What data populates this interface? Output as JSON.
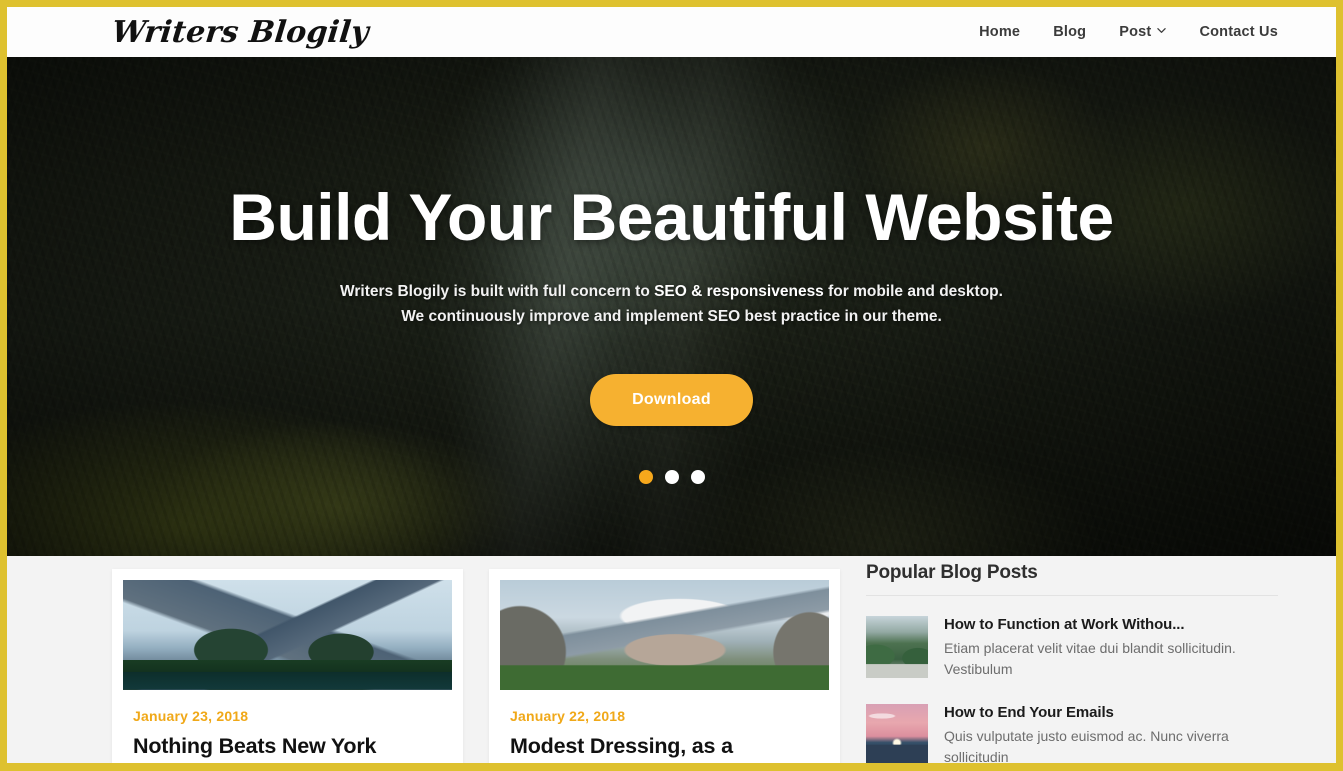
{
  "header": {
    "logo": "Writers Blogily",
    "nav": [
      {
        "label": "Home",
        "has_dropdown": false
      },
      {
        "label": "Blog",
        "has_dropdown": false
      },
      {
        "label": "Post",
        "has_dropdown": true
      },
      {
        "label": "Contact Us",
        "has_dropdown": false
      }
    ]
  },
  "hero": {
    "title": "Build Your Beautiful Website",
    "subtitle_part1": "Writers Blogily is built with full concern to ",
    "subtitle_emphasis": "SEO & responsiveness",
    "subtitle_part2": " for mobile and desktop.",
    "subtitle_line2": "We continuously improve and implement SEO best practice in our theme.",
    "button_label": "Download",
    "slide_count": 3,
    "active_slide": 1,
    "accent_color": "#f6b130",
    "dot_active_color": "#f6a81c"
  },
  "posts": [
    {
      "date": "January 23, 2018",
      "title": "Nothing Beats New York",
      "image_name": "mountain-lake-photo"
    },
    {
      "date": "January 22, 2018",
      "title": "Modest Dressing, as a",
      "image_name": "rock-valley-photo"
    }
  ],
  "sidebar": {
    "heading": "Popular Blog Posts",
    "items": [
      {
        "title": "How to Function at Work Withou...",
        "excerpt": "Etiam placerat velit vitae dui blandit sollicitudin. Vestibulum",
        "thumb_name": "river-valley-thumb"
      },
      {
        "title": "How to End Your Emails",
        "excerpt": "Quis vulputate justo euismod ac. Nunc viverra sollicitudin",
        "thumb_name": "ocean-sunset-thumb"
      }
    ]
  },
  "theme": {
    "page_border_color": "#dec12f",
    "date_color": "#f0a818",
    "background_color": "#f3f3f3"
  }
}
